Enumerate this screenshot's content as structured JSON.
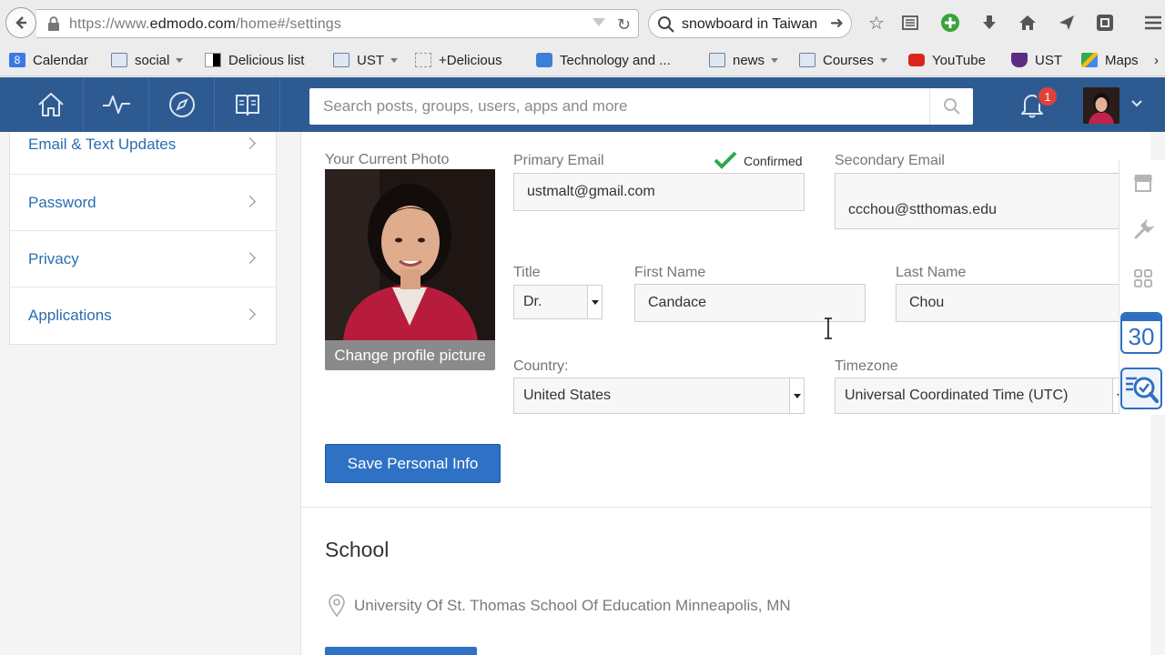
{
  "browser": {
    "url_prefix": "https://www.",
    "url_domain": "edmodo.com",
    "url_path": "/home#/settings",
    "search_value": "snowboard in Taiwan"
  },
  "bookmarks": [
    {
      "label": "Calendar",
      "icon": "google-calendar-icon"
    },
    {
      "label": "social",
      "icon": "folder-icon",
      "has_menu": true
    },
    {
      "label": "Delicious list",
      "icon": "delicious-icon"
    },
    {
      "label": "UST",
      "icon": "folder-icon",
      "has_menu": true
    },
    {
      "label": "+Delicious",
      "icon": "bookmarklet-icon"
    },
    {
      "label": "Technology and ...",
      "icon": "puzzle-icon"
    },
    {
      "label": "news",
      "icon": "folder-icon",
      "has_menu": true
    },
    {
      "label": "Courses",
      "icon": "folder-icon",
      "has_menu": true
    },
    {
      "label": "YouTube",
      "icon": "youtube-icon"
    },
    {
      "label": "UST",
      "icon": "ust-shield-icon"
    },
    {
      "label": "Maps",
      "icon": "maps-icon"
    }
  ],
  "appbar": {
    "search_placeholder": "Search posts, groups, users, apps and more",
    "notification_count": "1"
  },
  "sidebar": {
    "items": [
      {
        "label": "Email & Text Updates"
      },
      {
        "label": "Password"
      },
      {
        "label": "Privacy"
      },
      {
        "label": "Applications"
      }
    ]
  },
  "profile": {
    "photo_label": "Your Current Photo",
    "change_photo_button": "Change profile picture",
    "primary_email_label": "Primary Email",
    "primary_email_status": "Confirmed",
    "primary_email": "ustmalt@gmail.com",
    "secondary_email_label": "Secondary Email",
    "secondary_email": "ccchou@stthomas.edu",
    "title_label": "Title",
    "title_value": "Dr.",
    "first_name_label": "First Name",
    "first_name": "Candace",
    "last_name_label": "Last Name",
    "last_name": "Chou",
    "country_label": "Country:",
    "country": "United States",
    "timezone_label": "Timezone",
    "timezone": "Universal Coordinated Time (UTC)",
    "save_button": "Save Personal Info"
  },
  "school": {
    "heading": "School",
    "name": "University Of St. Thomas School Of Education Minneapolis, MN"
  },
  "right_toolbar": {
    "calendar_day": "30"
  },
  "colors": {
    "appbar": "#2e5a92",
    "link": "#2b6cb0",
    "primary_button": "#2f72c5",
    "badge": "#e2403b",
    "confirmed": "#2ea84a"
  }
}
